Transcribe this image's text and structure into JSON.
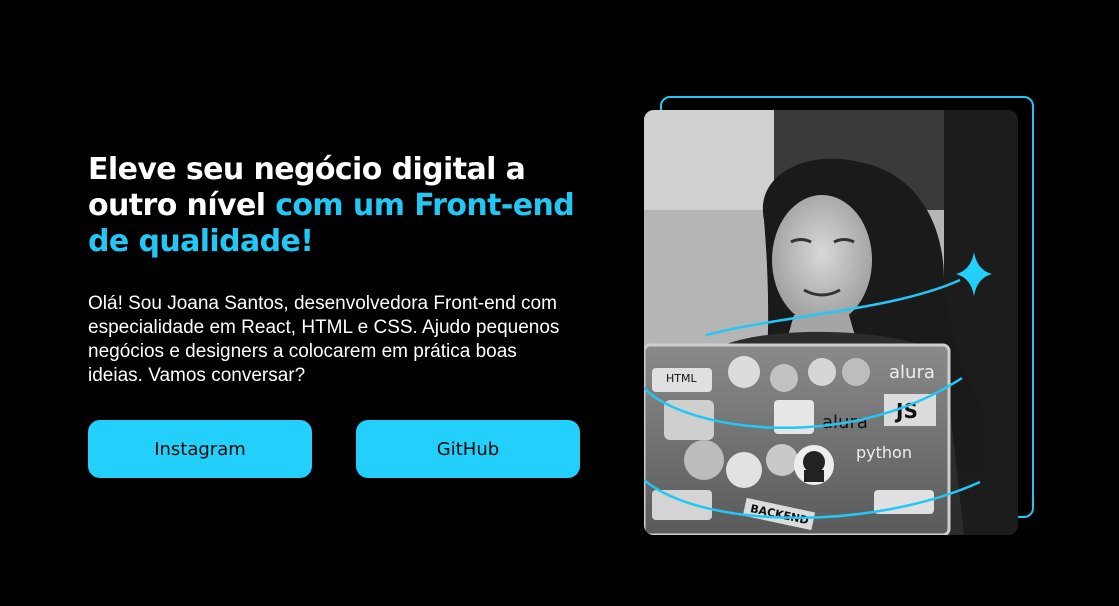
{
  "hero": {
    "headline_white": "Eleve seu negócio digital a outro nível ",
    "headline_accent": "com um Front-end de qualidade!",
    "intro": "Olá! Sou Joana Santos, desenvolvedora Front-end com especialidade em React, HTML e CSS. Ajudo pequenos negócios e designers a colocarem em prática boas ideias. Vamos conversar?"
  },
  "buttons": {
    "instagram_label": "Instagram",
    "github_label": "GitHub"
  },
  "photo": {
    "sticker_text_1": "alura",
    "sticker_text_2": "JS",
    "sticker_text_3": "python",
    "sticker_text_4": "BACKEND",
    "sticker_text_5": "HTML"
  },
  "colors": {
    "background": "#000000",
    "accent": "#22c8f5",
    "button": "#22d0fb",
    "button_text": "#0a0a0a"
  },
  "icons": [
    "sparkle-icon",
    "github-octocat-sticker"
  ]
}
